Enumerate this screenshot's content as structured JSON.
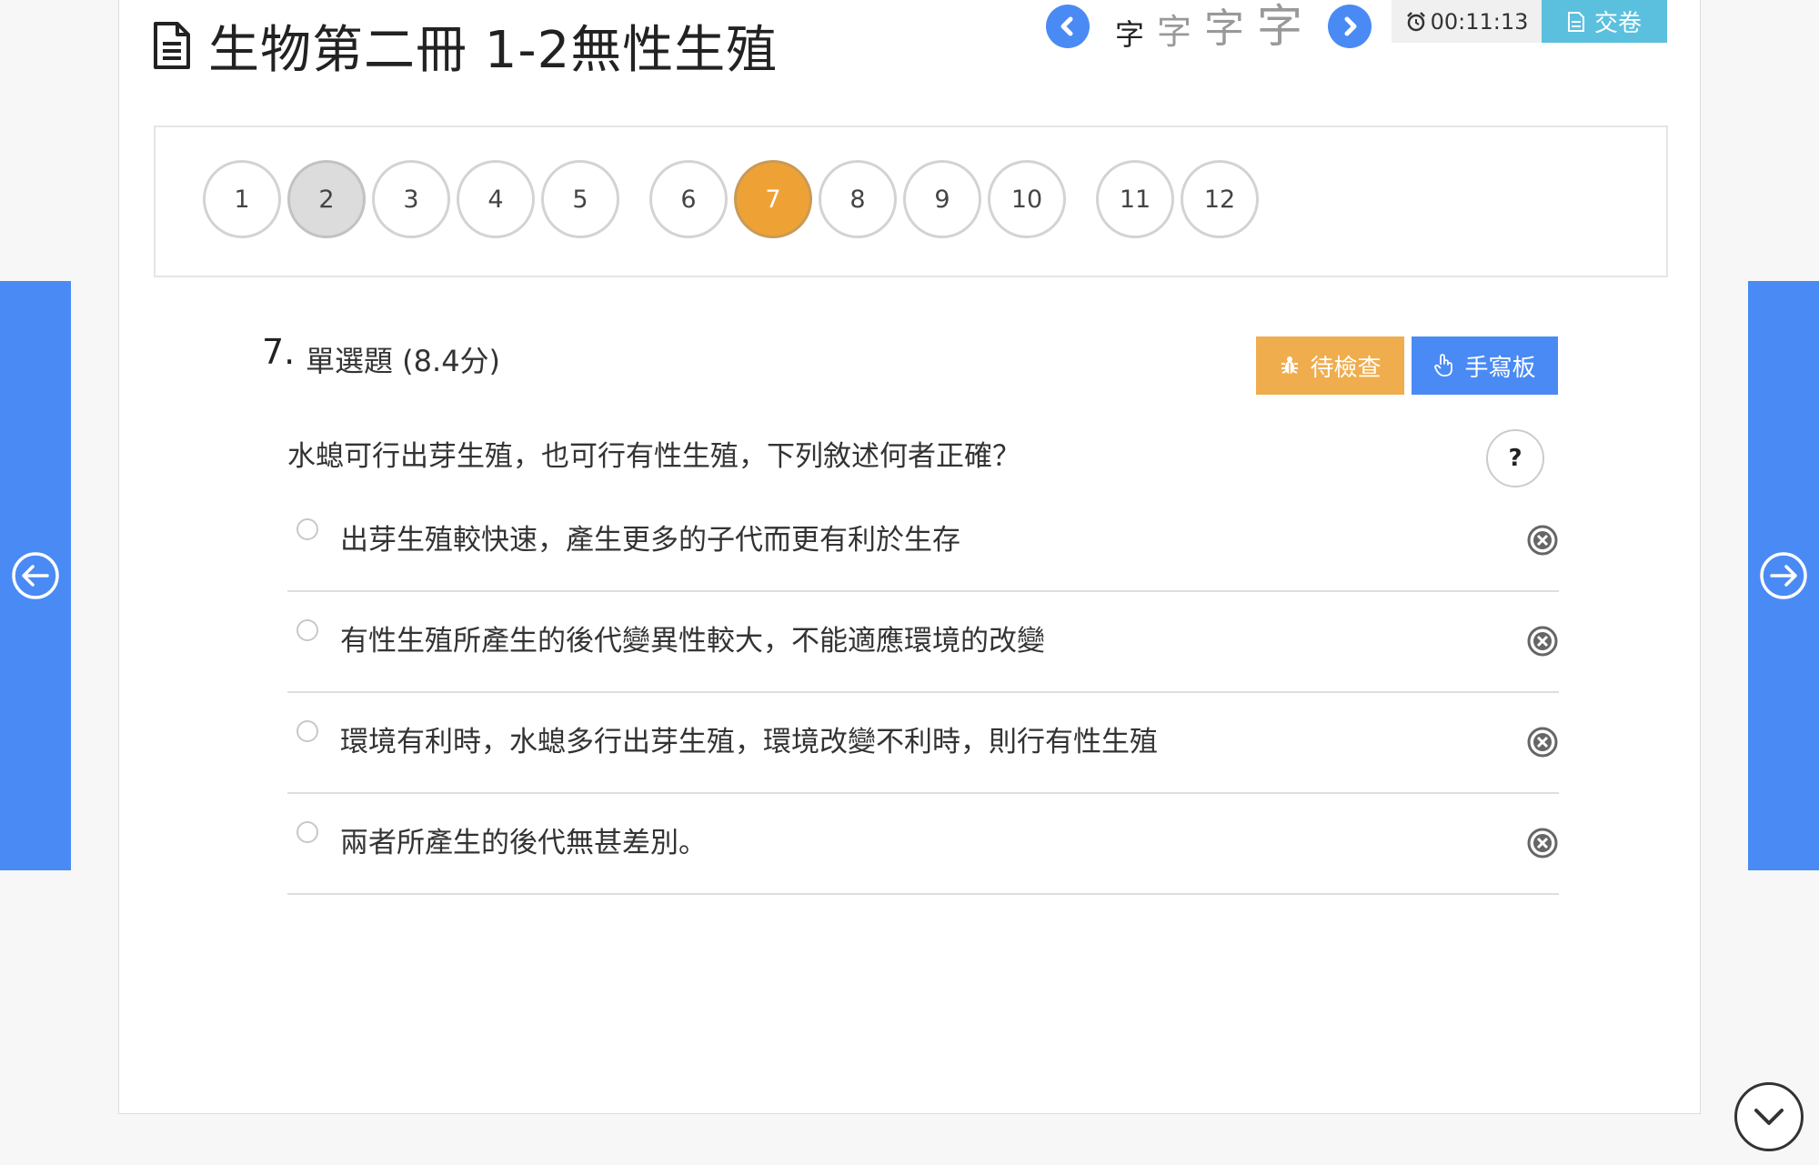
{
  "header": {
    "title": "生物第二冊 1-2無性生殖",
    "font_sizes": [
      "字",
      "字",
      "字",
      "字"
    ],
    "timer": "00:11:13",
    "submit_label": "交卷"
  },
  "question_nav": {
    "items": [
      {
        "label": "1",
        "state": "default"
      },
      {
        "label": "2",
        "state": "visited"
      },
      {
        "label": "3",
        "state": "default"
      },
      {
        "label": "4",
        "state": "default"
      },
      {
        "label": "5",
        "state": "default"
      },
      {
        "label": "6",
        "state": "default"
      },
      {
        "label": "7",
        "state": "current"
      },
      {
        "label": "8",
        "state": "default"
      },
      {
        "label": "9",
        "state": "default"
      },
      {
        "label": "10",
        "state": "default"
      },
      {
        "label": "11",
        "state": "default"
      },
      {
        "label": "12",
        "state": "default"
      }
    ]
  },
  "question": {
    "number": "7.",
    "type": "單選題 (8.4分)",
    "check_label": "待檢查",
    "handwriting_label": "手寫板",
    "text": "水螅可行出芽生殖，也可行有性生殖，下列敘述何者正確？",
    "help_label": "?",
    "options": [
      "出芽生殖較快速，產生更多的子代而更有利於生存",
      "有性生殖所產生的後代變異性較大，不能適應環境的改變",
      "環境有利時，水螅多行出芽生殖，環境改變不利時，則行有性生殖",
      "兩者所產生的後代無甚差別。"
    ]
  },
  "colors": {
    "primary": "#4a8af4",
    "warning": "#f0ad4e",
    "current_question": "#eea236",
    "submit": "#5bc0de"
  },
  "icons": {
    "title": "document-icon",
    "prev_font": "chevron-left-icon",
    "next_font": "chevron-right-icon",
    "timer": "alarm-clock-icon",
    "submit": "paper-icon",
    "check": "bug-icon",
    "handwriting": "hand-pointer-icon",
    "eliminate": "close-circle-icon",
    "prev_question": "arrow-left-circle-icon",
    "next_question": "arrow-right-circle-icon",
    "scroll": "chevron-down-icon"
  }
}
